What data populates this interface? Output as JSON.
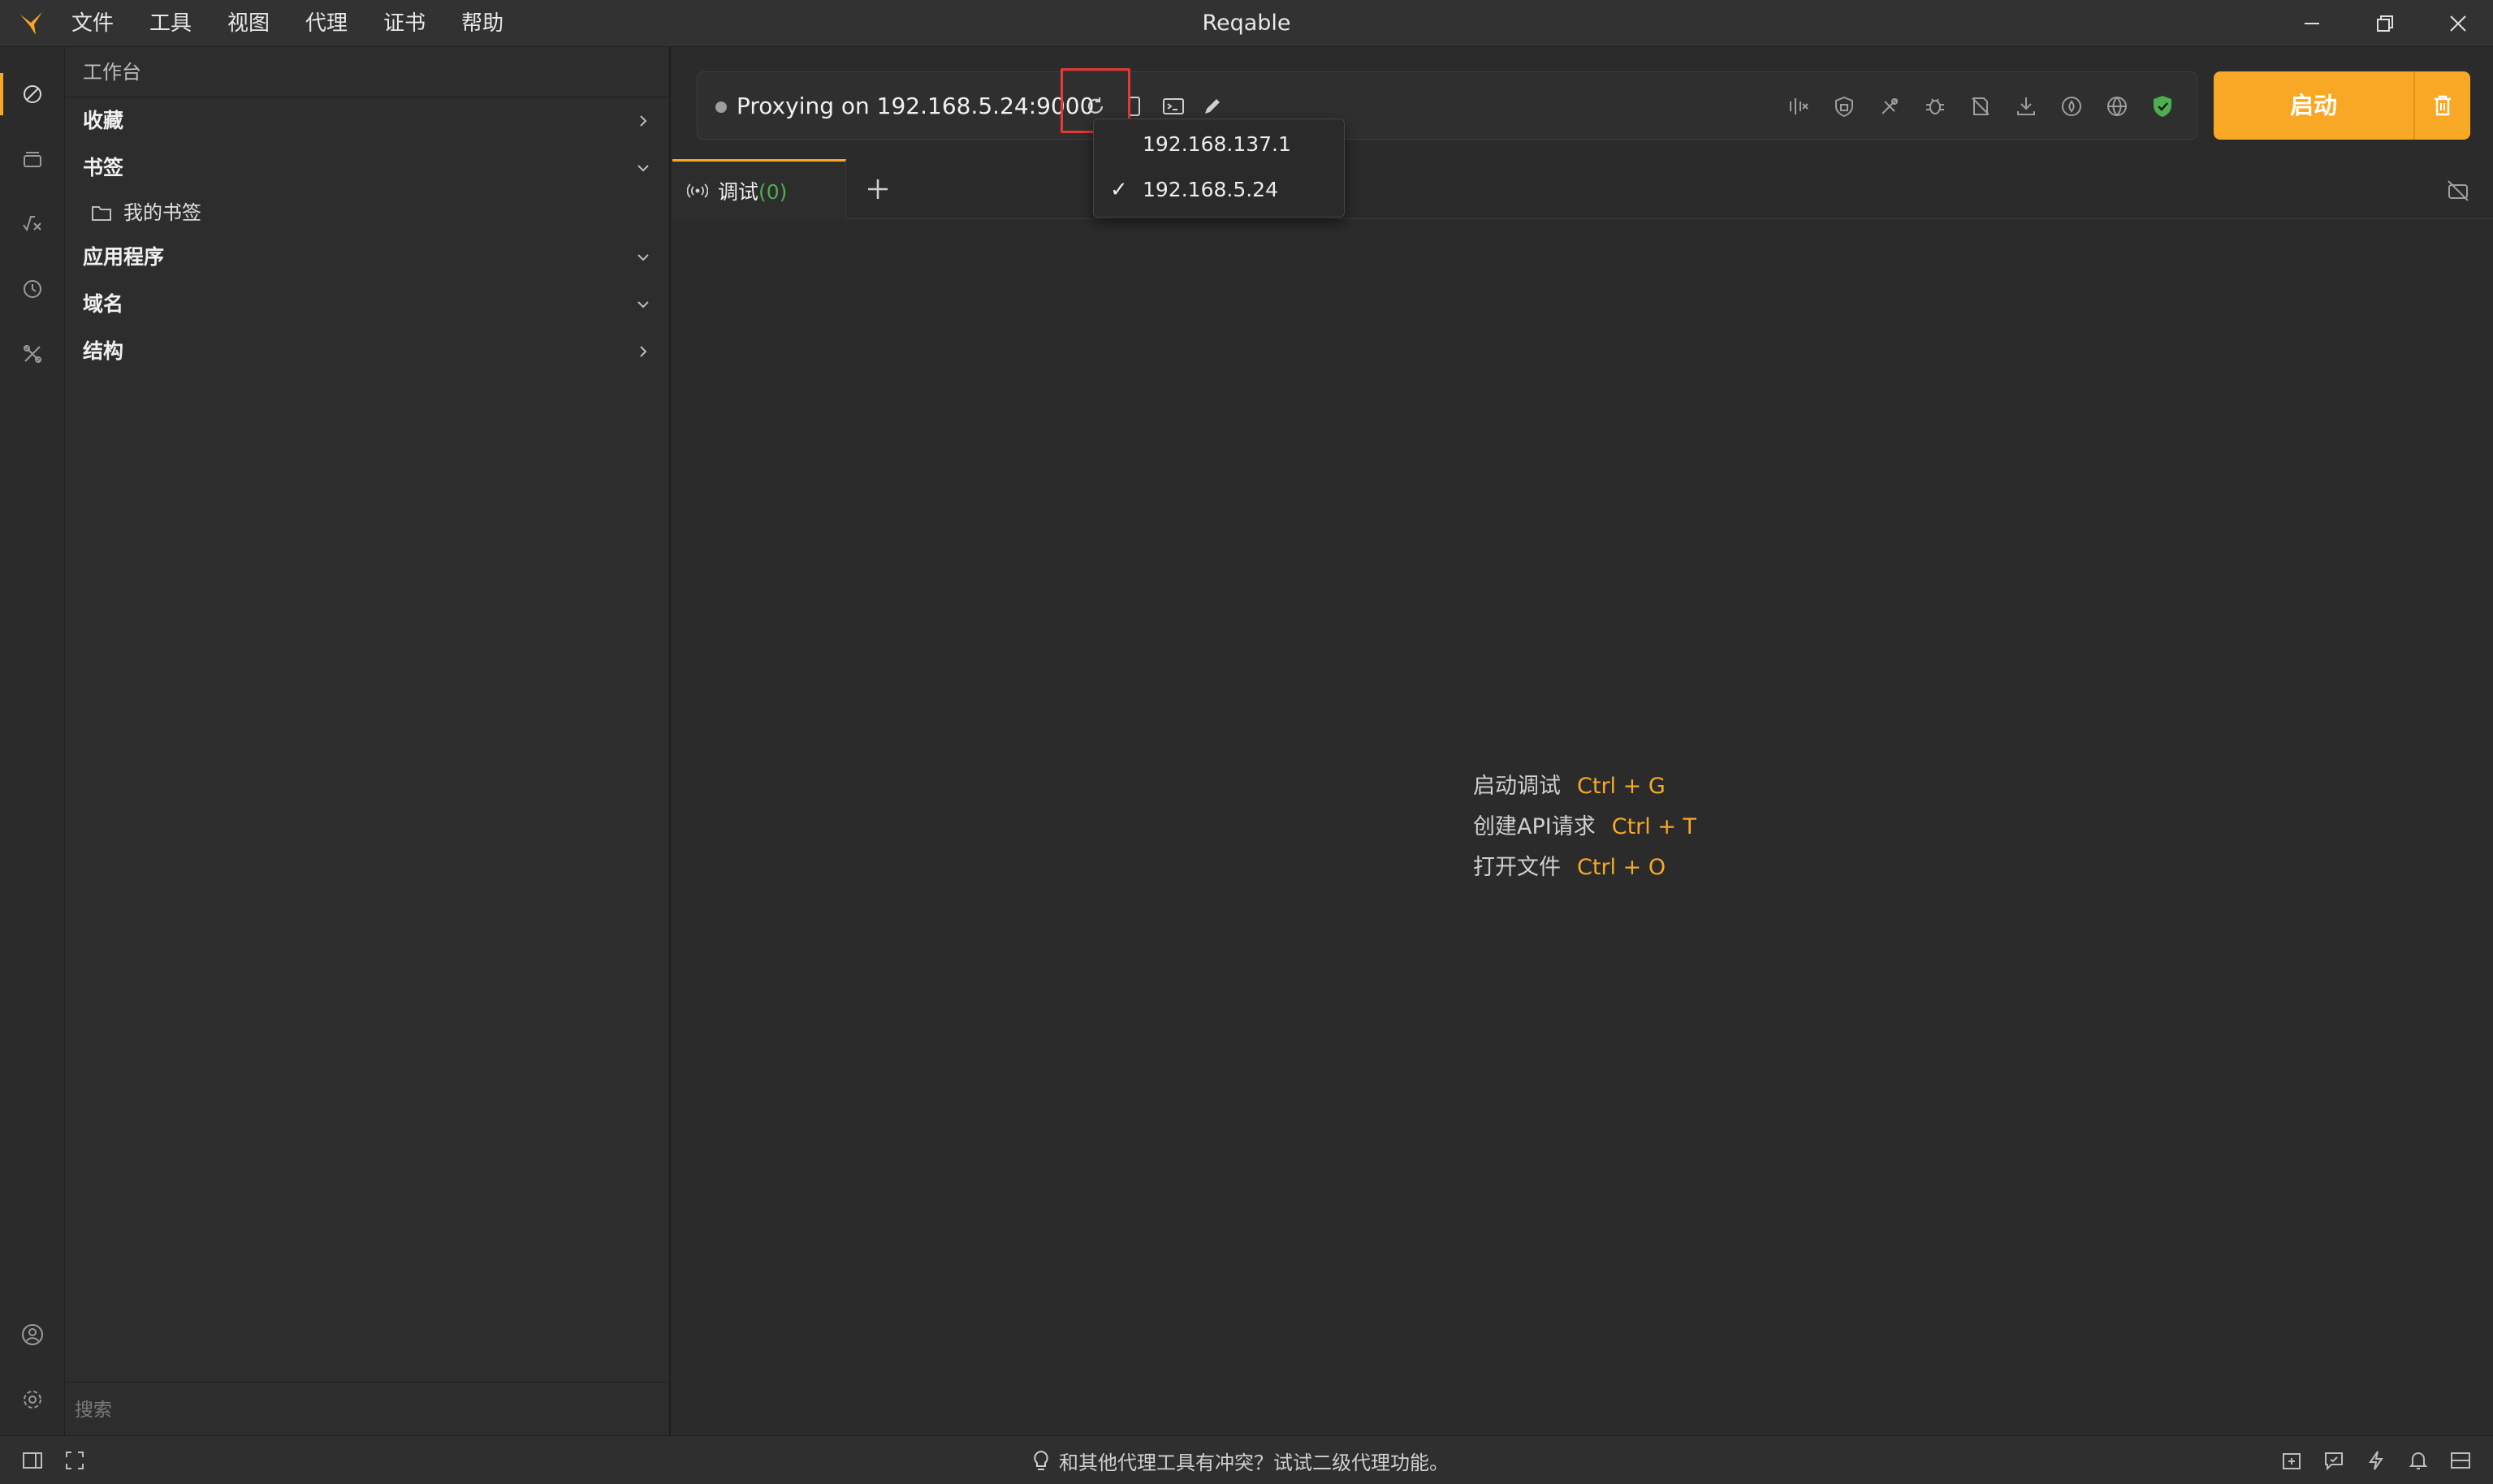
{
  "window": {
    "title": "Reqable",
    "controls": [
      "minimize-icon",
      "restore-icon",
      "close-icon"
    ]
  },
  "menu": [
    "文件",
    "工具",
    "视图",
    "代理",
    "证书",
    "帮助"
  ],
  "activity_bar": {
    "top": [
      "compass-icon",
      "layers-icon",
      "function-icon",
      "history-icon",
      "tools-icon"
    ],
    "bottom": [
      "account-icon",
      "settings-icon"
    ]
  },
  "sidebar": {
    "header": "工作台",
    "sections": [
      {
        "label": "收藏",
        "state": "collapsed"
      },
      {
        "label": "书签",
        "state": "expanded",
        "children": [
          "我的书签"
        ]
      },
      {
        "label": "应用程序",
        "state": "expanded"
      },
      {
        "label": "域名",
        "state": "expanded"
      },
      {
        "label": "结构",
        "state": "collapsed"
      }
    ],
    "search_placeholder": "搜索"
  },
  "toolbar": {
    "proxy_status": "Proxying on 192.168.5.24:9000",
    "left_icons": [
      "refresh-icon",
      "mobile-icon",
      "terminal-icon",
      "edit-icon"
    ],
    "right_icons": [
      "compare-icon",
      "ssl-icon",
      "rewrite-icon",
      "breakpoint-icon",
      "script-icon",
      "download-icon",
      "throttle-icon",
      "gateway-icon",
      "shield-icon"
    ],
    "start_label": "启动",
    "accent": "#f9a825",
    "shield_color": "#4caf50",
    "highlight_color": "#e53935"
  },
  "ip_dropdown": {
    "items": [
      "192.168.137.1",
      "192.168.5.24"
    ],
    "selected": "192.168.5.24",
    "check": "✓"
  },
  "tabs": {
    "debug": {
      "label": "调试",
      "count": "(0)"
    }
  },
  "hints": [
    {
      "label": "启动调试",
      "key": "Ctrl + G"
    },
    {
      "label": "创建API请求",
      "key": "Ctrl + T"
    },
    {
      "label": "打开文件",
      "key": "Ctrl + O"
    }
  ],
  "statusbar": {
    "tip": "和其他代理工具有冲突？试试二级代理功能。",
    "left_icons": [
      "sidebar-toggle-icon",
      "fullscreen-icon"
    ],
    "right_icons": [
      "export-icon",
      "feedback-icon",
      "flash-icon",
      "bell-icon",
      "layout-icon"
    ]
  }
}
